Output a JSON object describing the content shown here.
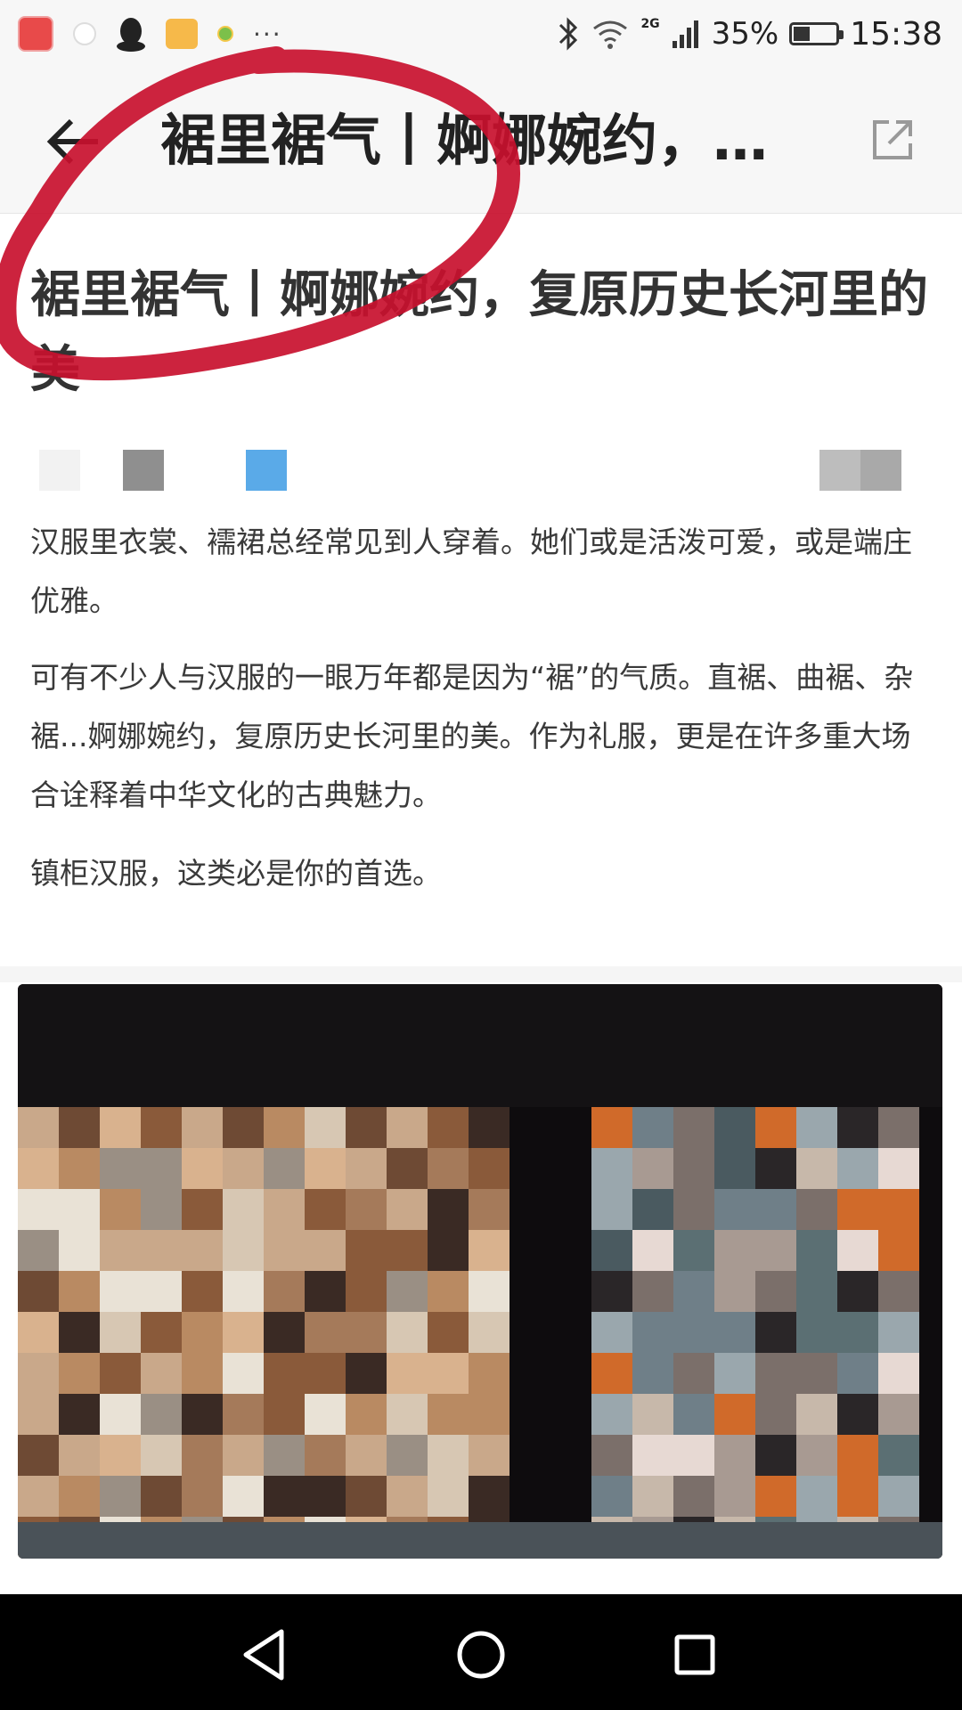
{
  "status_bar": {
    "battery_percent": "35%",
    "network": "2G",
    "time": "15:38",
    "more_indicator": "···",
    "icons": [
      "app-icon",
      "ghost-icon",
      "qq-icon",
      "cup-icon",
      "small-app-icon",
      "bluetooth-icon",
      "wifi-icon",
      "signal-icon",
      "battery-icon"
    ]
  },
  "header": {
    "title": "裾里裾气丨婀娜婉约，…",
    "back_icon": "arrow-left-icon",
    "share_icon": "open-external-icon"
  },
  "article": {
    "title": "裾里裾气丨婀娜婉约，复原历史长河里的美",
    "paragraphs": [
      "汉服里衣裳、襦裙总经常见到人穿着。她们或是活泼可爱，或是端庄优雅。",
      "可有不少人与汉服的一眼万年都是因为“裾”的气质。直裾、曲裾、杂裾...婀娜婉约，复原历史长河里的美。作为礼服，更是在许多重大场合诠释着中华文化的古典魅力。",
      "镇柜汉服，这类必是你的首选。"
    ],
    "photo": "pixelated-photo"
  },
  "annotation": {
    "marker_color": "#c8102e"
  },
  "nav_bar": {
    "icons": [
      "back-triangle-icon",
      "home-circle-icon",
      "recents-square-icon"
    ]
  },
  "colors": {
    "title_text": "#333333",
    "body_text": "#3a3a3a",
    "statusbar_bg": "#f7f7f7",
    "navbar_bg": "#000000",
    "accent_blue": "#5aaae8"
  }
}
